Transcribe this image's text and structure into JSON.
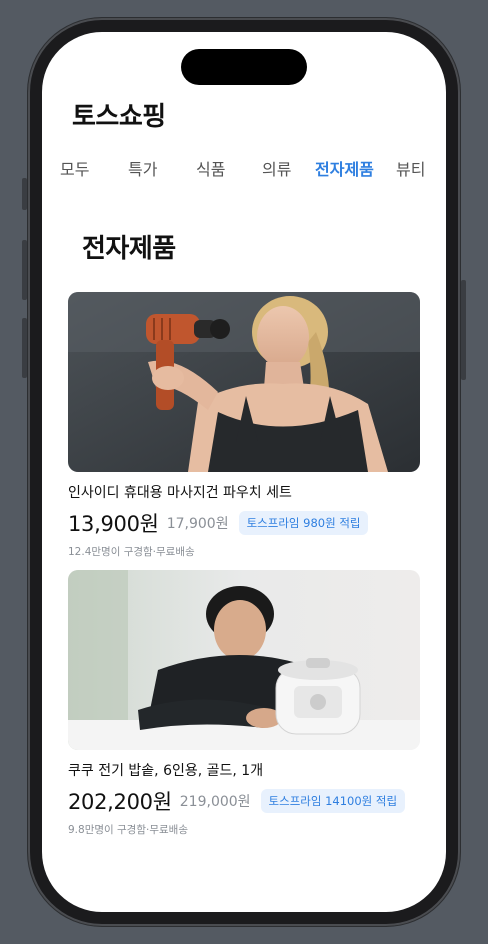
{
  "app": {
    "title": "토스쇼핑"
  },
  "tabs": [
    {
      "label": "모두"
    },
    {
      "label": "특가"
    },
    {
      "label": "식품"
    },
    {
      "label": "의류"
    },
    {
      "label": "전자제품",
      "active": true
    },
    {
      "label": "뷰티"
    }
  ],
  "section": {
    "title": "전자제품"
  },
  "products": [
    {
      "name": "인사이디 휴대용 마사지건 파우치 세트",
      "price": "13,900원",
      "original_price": "17,900원",
      "badge": "토스프라임 980원 적립",
      "meta": "12.4만명이 구경함·무료배송",
      "image": "massage-gun-photo"
    },
    {
      "name": "쿠쿠 전기 밥솥, 6인용, 골드, 1개",
      "price": "202,200원",
      "original_price": "219,000원",
      "badge": "토스프라임 14100원 적립",
      "meta": "9.8만명이 구경함·무료배송",
      "image": "rice-cooker-photo"
    }
  ],
  "colors": {
    "accent": "#2f7fe0",
    "badge_bg": "#e8f1fd",
    "muted": "#8a8f96"
  }
}
